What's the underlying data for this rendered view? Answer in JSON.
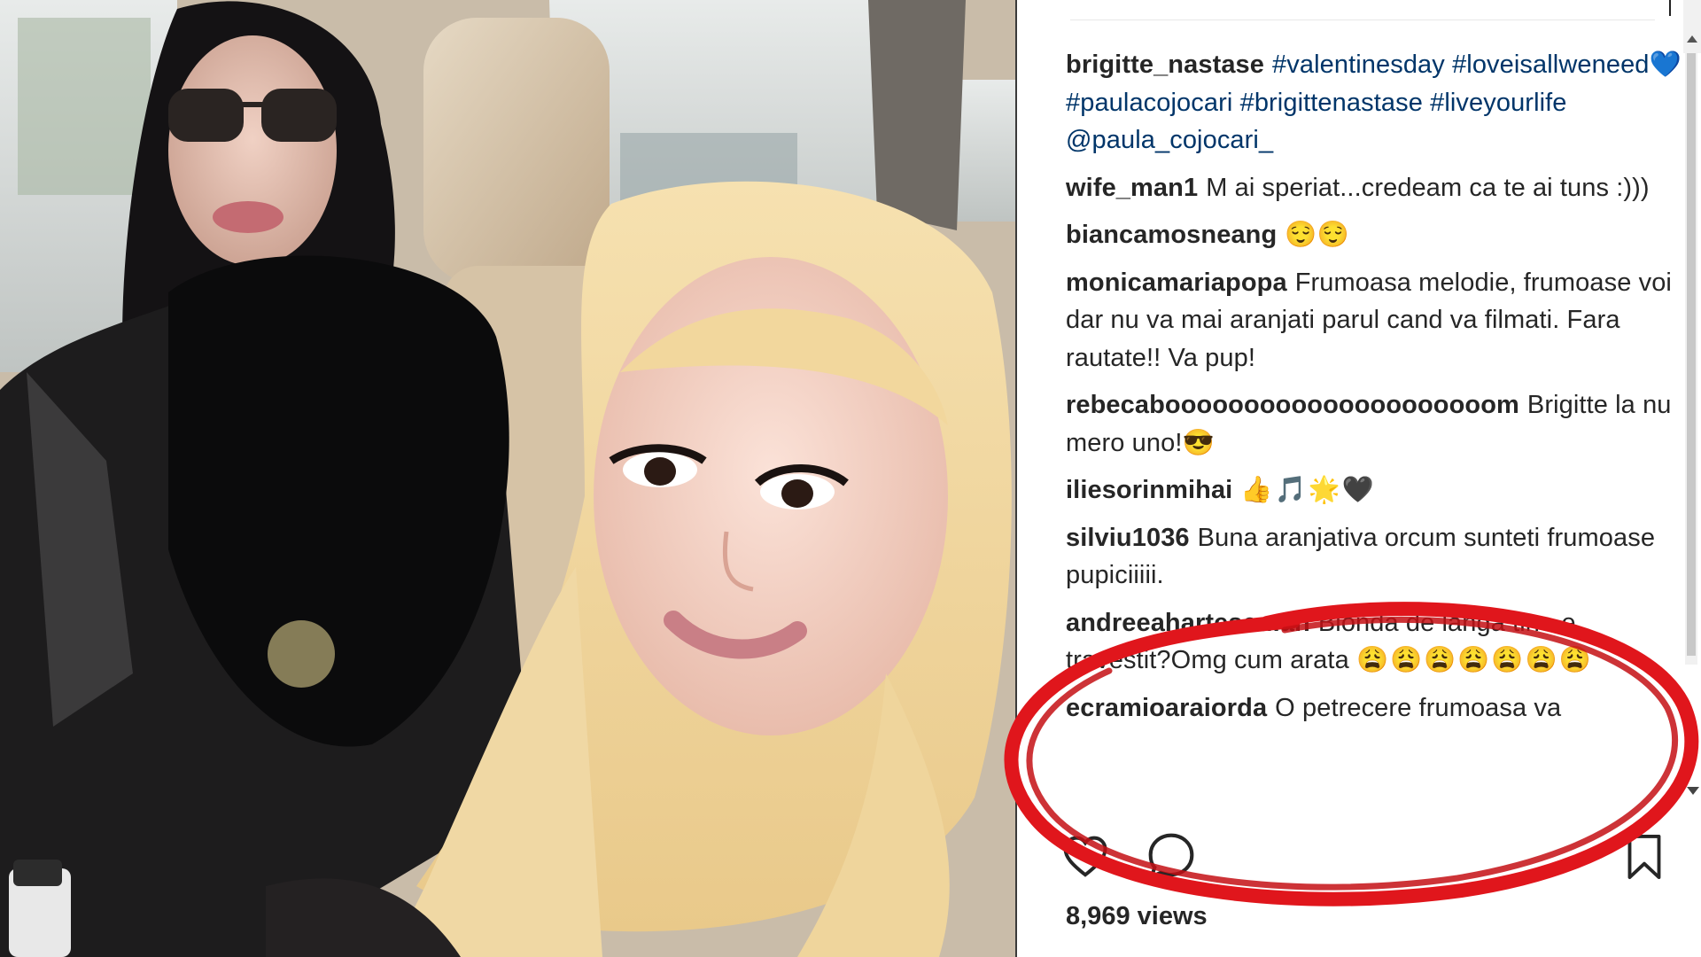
{
  "post": {
    "caption": {
      "user": "brigitte_nastase",
      "tags": [
        "#valentinesday",
        "#loveisallweneed💙",
        "#paulacojocari",
        "#brigittenastase",
        "#liveyourlife"
      ],
      "mention": "@paula_cojocari_"
    },
    "comments": [
      {
        "user": "wife_man1",
        "text": "M ai speriat...credeam ca te ai tuns :)))"
      },
      {
        "user": "biancamosneang",
        "text": "😌😌"
      },
      {
        "user": "monicamariapopa",
        "text": "Frumoasa melodie, frumoase voi dar nu va mai aranjati parul cand va filmati. Fara rautate!! Va pup!"
      },
      {
        "user": "rebecabooooooooooooooooooooom",
        "text": "Brigitte la numero uno!😎"
      },
      {
        "user": "iliesorinmihai",
        "text": "👍🎵🌟🖤"
      },
      {
        "user": "silviu1036",
        "text": "Buna aranjativa orcum sunteti frumoase pupiciiiii."
      },
      {
        "user": "andreeahartescu.ah",
        "text": "Blonda de langa tine e travestit?Omg cum arata",
        "emojis": "😩😩😩😩😩😩😩"
      },
      {
        "user": "ecramioaraiorda",
        "text": "O petrecere frumoasa va"
      }
    ],
    "views": "8,969 views"
  },
  "icons": {
    "like": "heart-outline-icon",
    "comment": "speech-bubble-icon",
    "save": "bookmark-icon"
  },
  "colors": {
    "hashtag": "#003569",
    "text": "#262626",
    "highlight_ring": "#e0161c"
  }
}
